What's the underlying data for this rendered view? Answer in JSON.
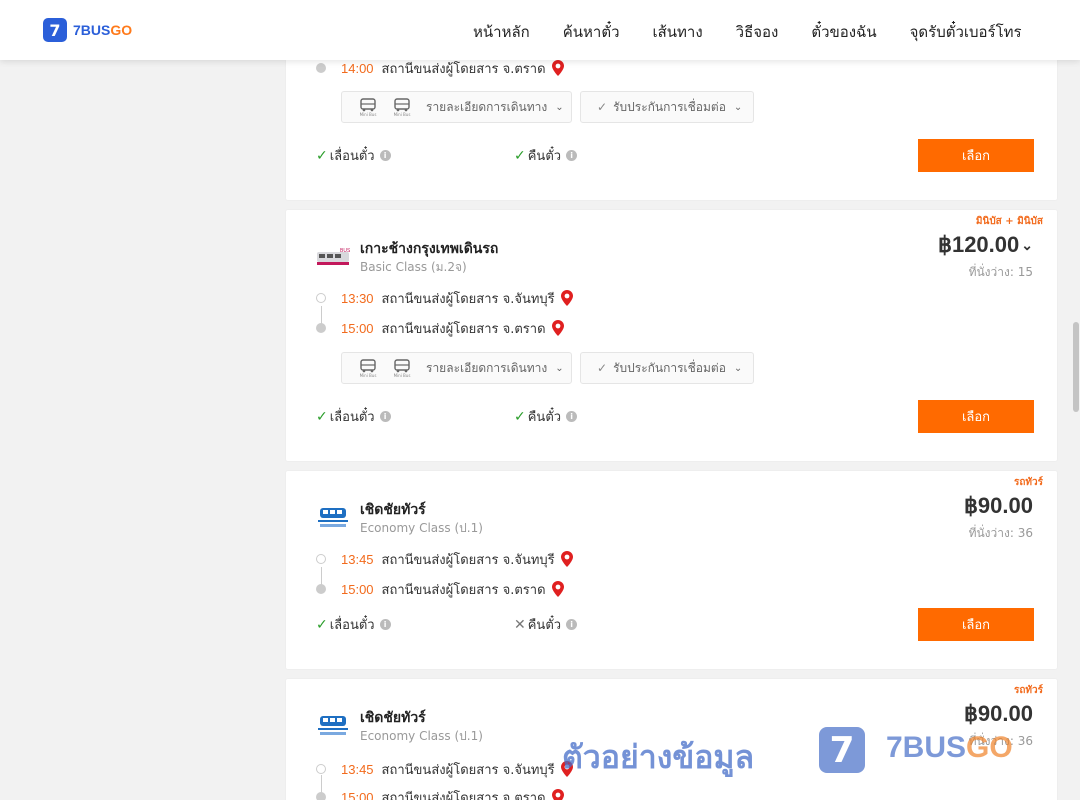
{
  "header": {
    "brand_left": "7BUS",
    "brand_right": "GO",
    "logo_digit": "7",
    "nav": [
      "หน้าหลัก",
      "ค้นหาตั๋ว",
      "เส้นทาง",
      "วิธีจอง",
      "ตั๋วของฉัน",
      "จุดรับตั๋วเบอร์โทร"
    ]
  },
  "labels": {
    "route_details": "รายละเอียดการเดินทาง",
    "connection_guarantee": "รับประกันการเชื่อมต่อ",
    "reschedule": "เลื่อนตั๋ว",
    "refund": "คืนตั๋ว",
    "select": "เลือก",
    "minibus_icon_label": "Mini Bus"
  },
  "cards": [
    {
      "stops": [
        {
          "time": "14:00",
          "station": "สถานีขนส่งผู้โดยสาร จ.ตราด"
        }
      ],
      "reschedule_ok": true,
      "refund_ok": true
    },
    {
      "tag": "มินิบัส + มินิบัส",
      "operator": "เกาะช้างกรุงเทพเดินรถ",
      "class": "Basic Class (ม.2จ)",
      "price": "฿120.00",
      "seats": "ที่นั่งว่าง: 15",
      "stops": [
        {
          "time": "13:30",
          "station": "สถานีขนส่งผู้โดยสาร จ.จันทบุรี"
        },
        {
          "time": "15:00",
          "station": "สถานีขนส่งผู้โดยสาร จ.ตราด"
        }
      ],
      "reschedule_ok": true,
      "refund_ok": true
    },
    {
      "tag": "รถทัวร์",
      "operator": "เชิดชัยทัวร์",
      "class": "Economy Class (ป.1)",
      "price": "฿90.00",
      "seats": "ที่นั่งว่าง: 36",
      "stops": [
        {
          "time": "13:45",
          "station": "สถานีขนส่งผู้โดยสาร จ.จันทบุรี"
        },
        {
          "time": "15:00",
          "station": "สถานีขนส่งผู้โดยสาร จ.ตราด"
        }
      ],
      "reschedule_ok": true,
      "refund_ok": false
    },
    {
      "tag": "รถทัวร์",
      "operator": "เชิดชัยทัวร์",
      "class": "Economy Class (ป.1)",
      "price": "฿90.00",
      "seats": "ที่นั่งว่าง: 36",
      "stops": [
        {
          "time": "13:45",
          "station": "สถานีขนส่งผู้โดยสาร จ.จันทบุรี"
        },
        {
          "time": "15:00",
          "station": "สถานีขนส่งผู้โดยสาร จ.ตราด"
        }
      ]
    }
  ],
  "watermark": {
    "text": "ตัวอย่างข้อมูล",
    "logo_digit": "7",
    "brand_left": "7BUS",
    "brand_right": "GO"
  },
  "colors": {
    "accent": "#ff6a00",
    "time": "#f26b1d",
    "brand_blue": "#2b5fd9",
    "check": "#2a9d2a"
  }
}
